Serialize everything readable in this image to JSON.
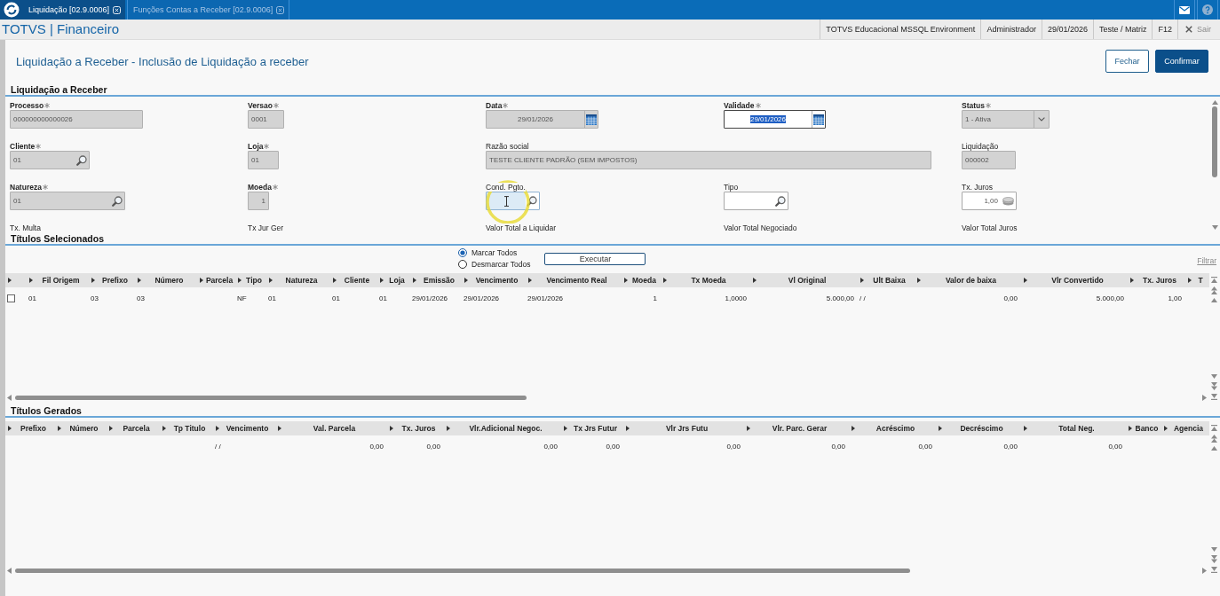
{
  "tabs": [
    {
      "label": "Liquidação [02.9.0006]",
      "selected": true
    },
    {
      "label": "Funções Contas a Receber [02.9.0006]",
      "selected": false
    }
  ],
  "header": {
    "app_title": "TOTVS | Financeiro",
    "info": [
      "TOTVS Educacional MSSQL Environment",
      "Administrador",
      "29/01/2026",
      "Teste / Matriz",
      "F12"
    ],
    "exit": {
      "label": "Sair",
      "disabled": true
    }
  },
  "page": {
    "title": "Liquidação a Receber - Inclusão de Liquidação a receber",
    "buttons": [
      {
        "label": "Fechar",
        "kind": "secondary"
      },
      {
        "label": "Confirmar",
        "kind": "primary"
      }
    ]
  },
  "form": {
    "title": "Liquidação a Receber",
    "fields": [
      {
        "label": "Processo",
        "required": true,
        "kind": "text",
        "value": "000000000000026",
        "disabled": true,
        "focused": false,
        "value_selected": false
      },
      {
        "label": "Versao",
        "required": true,
        "kind": "text",
        "value": "0001",
        "disabled": true,
        "focused": false,
        "value_selected": false
      },
      {
        "label": "Data",
        "required": true,
        "kind": "date",
        "value": "29/01/2026",
        "disabled": true,
        "focused": false,
        "value_selected": false
      },
      {
        "label": "Validade",
        "required": true,
        "kind": "date",
        "value": "29/01/2026",
        "disabled": false,
        "focused": false,
        "value_selected": true
      },
      {
        "label": "Status",
        "required": true,
        "kind": "select",
        "value": "1 - Ativa",
        "disabled": true,
        "focused": false,
        "value_selected": false
      },
      {
        "label": "Cliente",
        "required": true,
        "kind": "lookup",
        "value": "01",
        "disabled": true,
        "focused": false,
        "value_selected": false
      },
      {
        "label": "Loja",
        "required": true,
        "kind": "text",
        "value": "01",
        "disabled": true,
        "focused": false,
        "value_selected": false
      },
      {
        "label": "Razão social",
        "required": false,
        "kind": "text",
        "value": "TESTE CLIENTE PADRÃO (SEM IMPOSTOS)",
        "disabled": true,
        "focused": false,
        "value_selected": false
      },
      {
        "label": "Liquidação",
        "required": false,
        "kind": "text",
        "value": "000002",
        "disabled": true,
        "focused": false,
        "value_selected": false
      },
      {
        "label": "Natureza",
        "required": true,
        "kind": "lookup",
        "value": "01",
        "disabled": true,
        "focused": false,
        "value_selected": false
      },
      {
        "label": "Moeda",
        "required": true,
        "kind": "number",
        "value": "1",
        "disabled": true,
        "focused": false,
        "value_selected": false
      },
      {
        "label": "Cond. Pgto.",
        "required": false,
        "kind": "lookup",
        "disabled": false,
        "focused": true,
        "value_selected": false
      },
      {
        "label": "Tipo",
        "required": false,
        "kind": "lookup",
        "disabled": false,
        "focused": false,
        "value_selected": false
      },
      {
        "label": "Tx. Juros",
        "required": false,
        "kind": "calc",
        "value": "1,00",
        "disabled": false,
        "focused": false,
        "value_selected": false
      },
      {
        "label": "Tx. Multa",
        "required": false,
        "kind": "label"
      },
      {
        "label": "Tx Jur Ger",
        "required": false,
        "kind": "label"
      },
      {
        "label": "Valor Total a Liquidar",
        "required": false,
        "kind": "label"
      },
      {
        "label": "Valor Total Negociado",
        "required": false,
        "kind": "label"
      },
      {
        "label": "Valor Total Juros",
        "required": false,
        "kind": "label"
      }
    ]
  },
  "selected_titles": {
    "title": "Títulos Selecionados",
    "radios": [
      {
        "label": "Marcar Todos",
        "selected": true
      },
      {
        "label": "Desmarcar Todos",
        "selected": false
      }
    ],
    "execute_button": "Executar",
    "filter_link": "Filtrar",
    "table": {
      "columns": [
        "Fil Origem",
        "Prefixo",
        "Número",
        "Parcela",
        "Tipo",
        "Natureza",
        "Cliente",
        "Loja",
        "Emissão",
        "Vencimento",
        "Vencimento Real",
        "Moeda",
        "Tx Moeda",
        "Vl Original",
        "Ult Baixa",
        "Valor de baixa",
        "Vlr Convertido",
        "Tx. Juros",
        "T"
      ],
      "rows": [
        {
          "checked": false,
          "cells": [
            "01",
            "03",
            "03",
            null,
            "NF",
            "01",
            "01",
            "01",
            "29/01/2026",
            "29/01/2026",
            "29/01/2026",
            "1",
            "1,0000",
            "5.000,00",
            "/ /",
            "0,00",
            "5.000,00",
            "1,00",
            null
          ]
        }
      ]
    }
  },
  "generated_titles": {
    "title": "Títulos Gerados",
    "table": {
      "columns": [
        "Prefixo",
        "Número",
        "Parcela",
        "Tp Titulo",
        "Vencimento",
        "Val. Parcela",
        "Tx. Juros",
        "Vlr.Adicional Negoc.",
        "Tx Jrs Futur",
        "Vlr Jrs Futu",
        "Vlr. Parc. Gerar",
        "Acréscimo",
        "Decréscimo",
        "Total Neg.",
        "Banco",
        "Agencia"
      ],
      "rows": [
        {
          "cells": [
            null,
            null,
            null,
            null,
            "/ /",
            "0,00",
            "0,00",
            "0,00",
            "0,00",
            "0,00",
            "0,00",
            "0,00",
            "0,00",
            "0,00",
            null,
            null
          ]
        }
      ]
    }
  }
}
